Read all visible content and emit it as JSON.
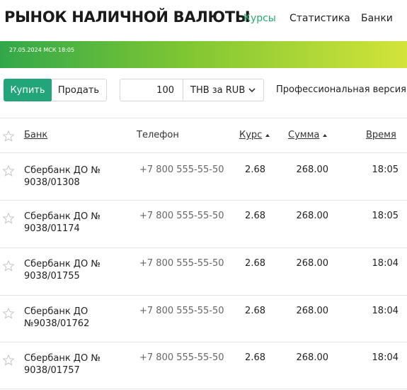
{
  "site": {
    "title": "РЫНОК НАЛИЧНОЙ ВАЛЮТЫ"
  },
  "nav": {
    "items": [
      {
        "label": "Курсы",
        "active": true
      },
      {
        "label": "Статистика"
      },
      {
        "label": "Банки"
      }
    ]
  },
  "banner": {
    "text": "27.05.2024 МСК 18:05"
  },
  "controls": {
    "buy_label": "Купить",
    "sell_label": "Продать",
    "amount": "100",
    "currency_pair": "THB за RUB",
    "pro_version": "Профессиональная версия"
  },
  "table": {
    "headers": {
      "bank": "Банк",
      "phone": "Телефон",
      "rate": "Курс",
      "sum": "Сумма",
      "time": "Время"
    },
    "rows": [
      {
        "bank": "Сбербанк ДО № 9038/01308",
        "phone": "+7 800 555-55-50",
        "rate": "2.68",
        "sum": "268.00",
        "time": "18:05"
      },
      {
        "bank": "Сбербанк ДО № 9038/01174",
        "phone": "+7 800 555-55-50",
        "rate": "2.68",
        "sum": "268.00",
        "time": "18:05"
      },
      {
        "bank": "Сбербанк ДО № 9038/01755",
        "phone": "+7 800 555-55-50",
        "rate": "2.68",
        "sum": "268.00",
        "time": "18:04"
      },
      {
        "bank": "Сбербанк ДО №9038/01762",
        "phone": "+7 800 555-55-50",
        "rate": "2.68",
        "sum": "268.00",
        "time": "18:04"
      },
      {
        "bank": "Сбербанк ДО № 9038/01757",
        "phone": "+7 800 555-55-50",
        "rate": "2.68",
        "sum": "268.00",
        "time": "18:04"
      }
    ]
  },
  "colors": {
    "accent": "#2aa870",
    "buy_button": "#23a57a",
    "banner_start": "#32a84a",
    "banner_end": "#d3e43a"
  },
  "icons": {
    "favorite": "star-outline-icon",
    "dropdown": "chevron-down-icon"
  }
}
